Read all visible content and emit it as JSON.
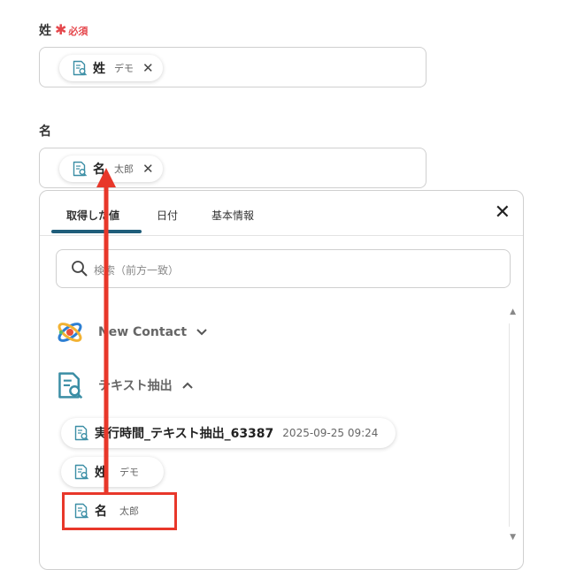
{
  "fields": {
    "last_name": {
      "label": "姓",
      "required_mark": "✱",
      "required_text": "必須",
      "chip": {
        "name": "姓",
        "value": "デモ",
        "close": "✕"
      }
    },
    "first_name": {
      "label": "名",
      "chip": {
        "name": "名",
        "value": "太郎",
        "close": "✕"
      }
    }
  },
  "panel": {
    "tabs": [
      {
        "label": "取得した値",
        "active": true
      },
      {
        "label": "日付",
        "active": false
      },
      {
        "label": "基本情報",
        "active": false
      }
    ],
    "close": "✕",
    "search": {
      "placeholder": "検索（前方一致）"
    },
    "groups": [
      {
        "label": "New Contact",
        "expanded": false
      },
      {
        "label": "テキスト抽出",
        "expanded": true
      }
    ],
    "items": [
      {
        "name": "実行時間_テキスト抽出_63387",
        "value": "2025-09-25 09:24"
      },
      {
        "name": "姓",
        "value": "デモ"
      },
      {
        "name": "名",
        "value": "太郎"
      }
    ],
    "scroll_up": "▲",
    "scroll_down": "▼"
  },
  "colors": {
    "accent": "#1f5d7a",
    "required": "#e5484d",
    "highlight": "#e8372a",
    "icon_teal": "#3b8ea5"
  }
}
